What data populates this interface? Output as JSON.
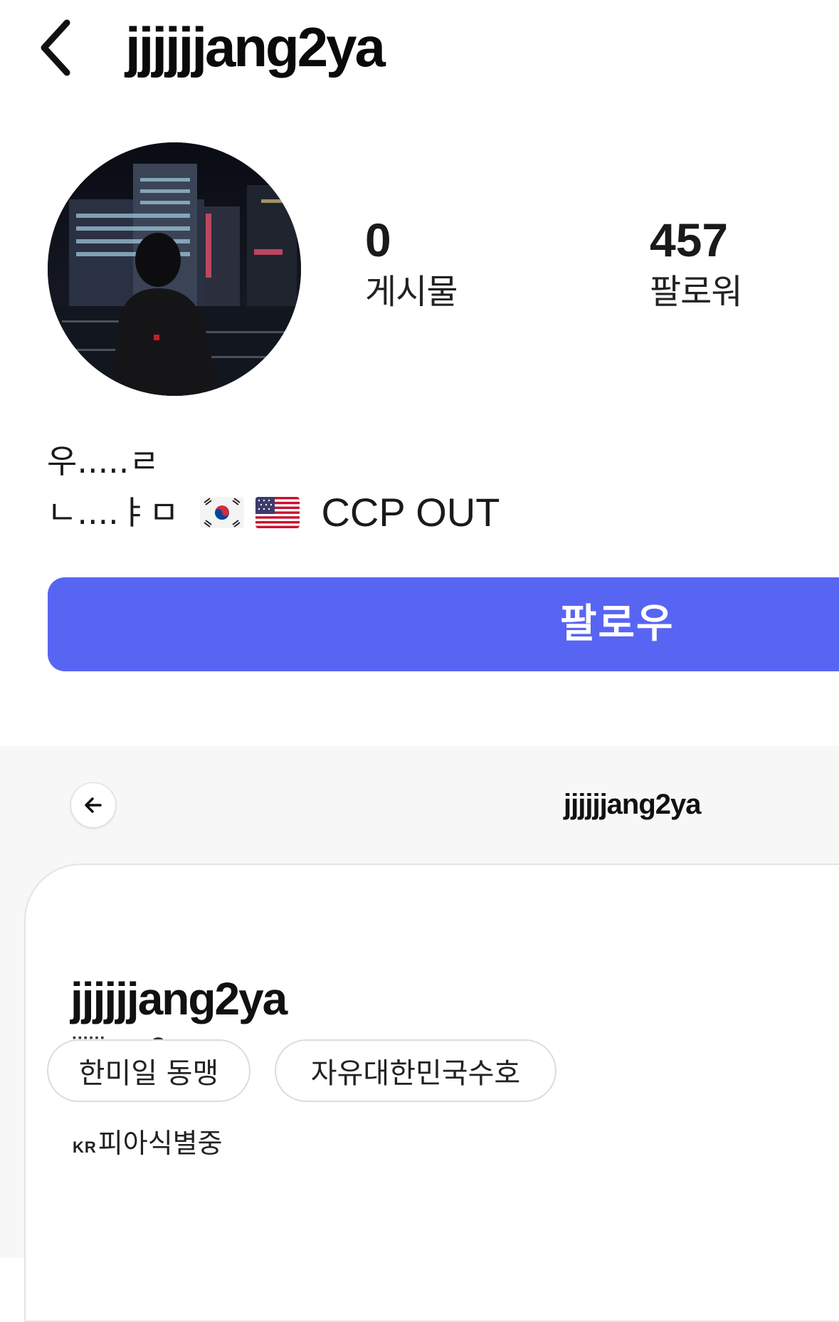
{
  "mobile_profile": {
    "username": "jjjjjjang2ya",
    "stats": [
      {
        "value": "0",
        "label": "게시물"
      },
      {
        "value": "457",
        "label": "팔로워"
      }
    ],
    "bio": {
      "line1": "우.....ㄹ",
      "line2_text": "ㄴ....ㅑㅁ",
      "line2_flags": [
        "south-korea-flag",
        "usa-flag"
      ],
      "line2_tail": "CCP OUT"
    },
    "follow_label": "팔로우",
    "accent_color": "#5865f2"
  },
  "web_profile": {
    "header_title": "jjjjjjang2ya",
    "display_name": "jjjjjjang2ya",
    "handle": "jjjjjjang2ya",
    "bio_prefix": "KR",
    "bio_text": "피아식별중",
    "tags": [
      "한미일 동맹",
      "자유대한민국수호"
    ]
  }
}
